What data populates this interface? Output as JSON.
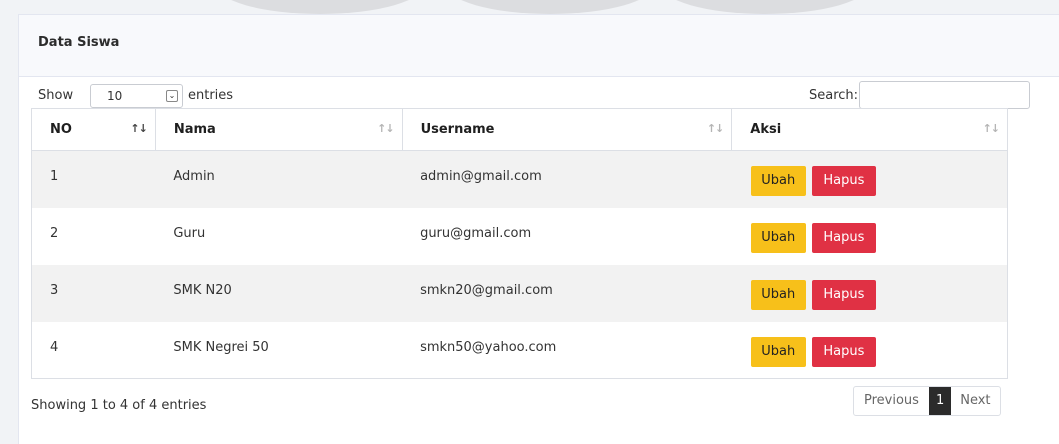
{
  "card": {
    "title": "Data Siswa"
  },
  "controls": {
    "show_label": "Show",
    "length_value": "10",
    "entries_label": "entries",
    "search_label": "Search:"
  },
  "table": {
    "headers": [
      "NO",
      "Nama",
      "Username",
      "Aksi"
    ],
    "rows": [
      {
        "no": "1",
        "nama": "Admin",
        "username": "admin@gmail.com"
      },
      {
        "no": "2",
        "nama": "Guru",
        "username": "guru@gmail.com"
      },
      {
        "no": "3",
        "nama": "SMK N20",
        "username": "smkn20@gmail.com"
      },
      {
        "no": "4",
        "nama": "SMK Negrei 50",
        "username": "smkn50@yahoo.com"
      }
    ],
    "edit_label": "Ubah",
    "delete_label": "Hapus"
  },
  "footer": {
    "info": "Showing 1 to 4 of 4 entries",
    "previous": "Previous",
    "page": "1",
    "next": "Next"
  },
  "colors": {
    "edit": "#f7c01a",
    "delete": "#e03144",
    "active_page": "#2b2b2b"
  },
  "icons": {
    "sort": "sort-icon",
    "dropdown": "chevron-down-icon"
  }
}
